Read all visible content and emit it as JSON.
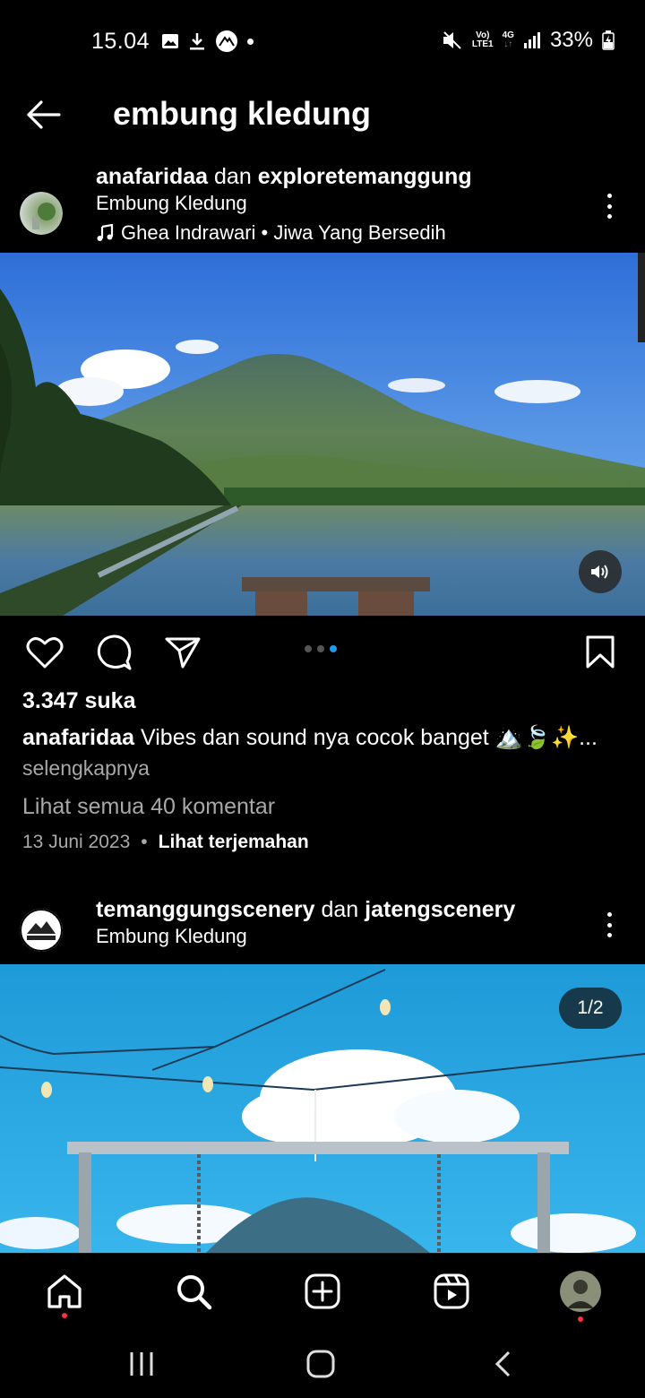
{
  "status_bar": {
    "time": "15.04",
    "signal_label_top": "Vo)",
    "signal_label_bottom": "LTE1",
    "network": "4G",
    "battery": "33%"
  },
  "header": {
    "title": "embung kledung"
  },
  "post1": {
    "user1": "anafaridaa",
    "joiner": "dan",
    "user2": "exploretemanggung",
    "location": "Embung Kledung",
    "music": "Ghea Indrawari • Jiwa Yang Bersedih",
    "likes": "3.347 suka",
    "caption_user": "anafaridaa",
    "caption_text": "Vibes dan sound nya cocok banget",
    "caption_emoji": "🏔️🍃✨...",
    "more_label": "selengkapnya",
    "comments_label": "Lihat semua 40 komentar",
    "date": "13 Juni 2023",
    "separator": "•",
    "translate_label": "Lihat terjemahan",
    "carousel_dots": 3,
    "carousel_active": 3
  },
  "post2": {
    "user1": "temanggungscenery",
    "joiner": "dan",
    "user2": "jatengscenery",
    "location": "Embung Kledung",
    "counter": "1/2"
  },
  "colors": {
    "background": "#000000",
    "accent_blue": "#1d9bf0",
    "notification_red": "#ff3040",
    "secondary_text": "#a8a8a8"
  },
  "icons": {
    "back": "arrow-left-icon",
    "more": "more-vertical-icon",
    "music": "music-note-icon",
    "sound": "speaker-icon",
    "like": "heart-icon",
    "comment": "comment-icon",
    "share": "send-icon",
    "save": "bookmark-icon",
    "home": "home-icon",
    "search": "search-icon",
    "create": "plus-square-icon",
    "reels": "reels-icon"
  }
}
